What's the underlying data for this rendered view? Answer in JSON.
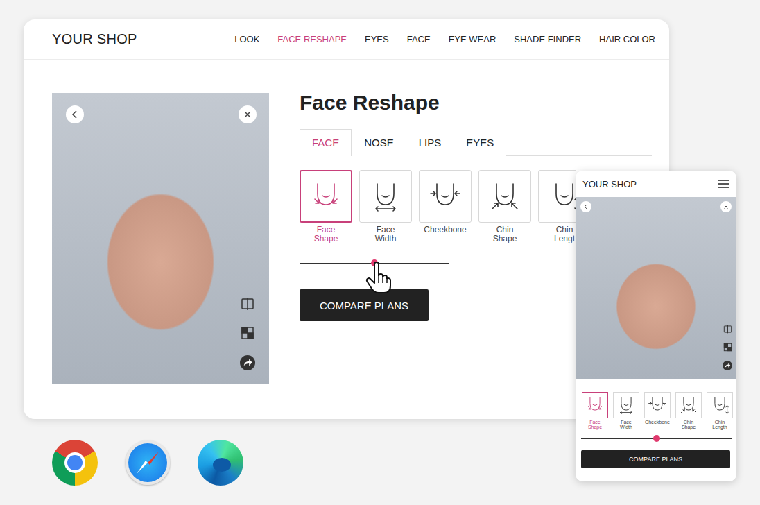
{
  "shop": {
    "title": "YOUR SHOP"
  },
  "nav": [
    {
      "label": "LOOK",
      "selected": false
    },
    {
      "label": "FACE RESHAPE",
      "selected": true
    },
    {
      "label": "EYES",
      "selected": false
    },
    {
      "label": "FACE",
      "selected": false
    },
    {
      "label": "EYE WEAR",
      "selected": false
    },
    {
      "label": "SHADE FINDER",
      "selected": false
    },
    {
      "label": "HAIR COLOR",
      "selected": false
    }
  ],
  "panel": {
    "title": "Face Reshape",
    "tabs": [
      {
        "label": "FACE",
        "selected": true
      },
      {
        "label": "NOSE",
        "selected": false
      },
      {
        "label": "LIPS",
        "selected": false
      },
      {
        "label": "EYES",
        "selected": false
      }
    ],
    "options": [
      {
        "label": "Face Shape",
        "selected": true
      },
      {
        "label": "Face Width",
        "selected": false
      },
      {
        "label": "Cheekbone",
        "selected": false
      },
      {
        "label": "Chin Shape",
        "selected": false
      },
      {
        "label": "Chin Lengt",
        "selected": false
      }
    ],
    "slider": {
      "level": 0.5
    },
    "button": "COMPARE PLANS"
  },
  "mobile": {
    "title": "YOUR SHOP",
    "options": [
      {
        "label": "Face Shape",
        "selected": true
      },
      {
        "label": "Face Width",
        "selected": false
      },
      {
        "label": "Cheekbone",
        "selected": false
      },
      {
        "label": "Chin Shape",
        "selected": false
      },
      {
        "label": "Chin Length",
        "selected": false
      }
    ],
    "slider": {
      "level": 0.5
    },
    "button": "COMPARE PLANS"
  }
}
